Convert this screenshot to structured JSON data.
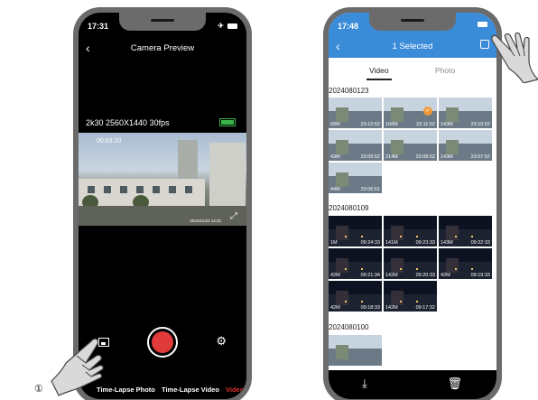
{
  "step_marker": "①",
  "camera_preview": {
    "status_time": "17:31",
    "title": "Camera Preview",
    "back_icon": "chevron-left-icon",
    "resolution": "2k30 2560X1440 30fps",
    "battery_color": "#3bb54a",
    "elapsed": "00:03:20",
    "timestamp": "2024/11/22 14:32",
    "modes": [
      "o",
      "Time-Lapse Photo",
      "Time-Lapse Video",
      "Video"
    ],
    "active_mode": "Video",
    "record_color": "#e03a3a"
  },
  "gallery": {
    "status_time": "17:48",
    "title": "1 Selected",
    "accent_color": "#3a8bd8",
    "tabs": [
      "Video",
      "Photo"
    ],
    "active_tab": "Video",
    "groups": [
      {
        "date": "2024080123",
        "items": [
          {
            "size": "09M",
            "time": "23:12:52",
            "night": false,
            "selected": false
          },
          {
            "size": "166M",
            "time": "23:11:52",
            "night": false,
            "selected": true
          },
          {
            "size": "143M",
            "time": "23:10:52",
            "night": false,
            "selected": false
          },
          {
            "size": "43M",
            "time": "23:09:52",
            "night": false,
            "selected": false
          },
          {
            "size": "214M",
            "time": "23:08:52",
            "night": false,
            "selected": false
          },
          {
            "size": "143M",
            "time": "23:07:52",
            "night": false,
            "selected": false
          },
          {
            "size": "44M",
            "time": "23:06:51",
            "night": false,
            "selected": false
          }
        ]
      },
      {
        "date": "2024080109",
        "items": [
          {
            "size": "1M",
            "time": "09:24:33",
            "night": true,
            "selected": false
          },
          {
            "size": "141M",
            "time": "09:23:33",
            "night": true,
            "selected": false
          },
          {
            "size": "143M",
            "time": "09:22:33",
            "night": true,
            "selected": false
          },
          {
            "size": "42M",
            "time": "09:21:34",
            "night": true,
            "selected": false
          },
          {
            "size": "142M",
            "time": "09:20:33",
            "night": true,
            "selected": false
          },
          {
            "size": "42M",
            "time": "09:19:33",
            "night": true,
            "selected": false
          },
          {
            "size": "42M",
            "time": "09:18:33",
            "night": true,
            "selected": false
          },
          {
            "size": "142M",
            "time": "09:17:32",
            "night": true,
            "selected": false
          }
        ]
      },
      {
        "date": "2024080100",
        "items": [
          {
            "size": "",
            "time": "",
            "night": false,
            "selected": false
          }
        ]
      }
    ],
    "download_icon": "download-icon",
    "delete_icon": "trash-icon"
  }
}
